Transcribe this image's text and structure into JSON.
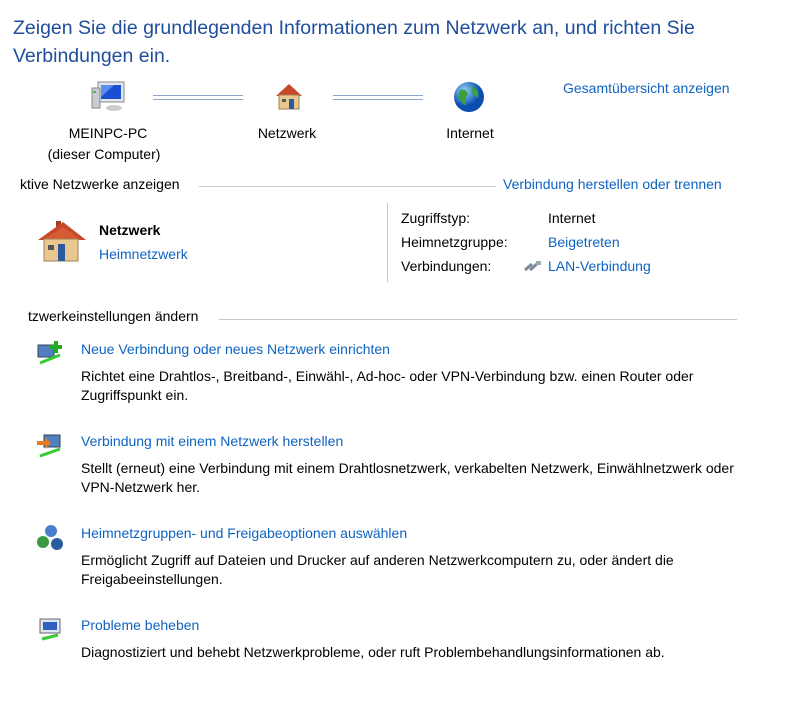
{
  "header": {
    "line1": "Zeigen Sie die grundlegenden Informationen zum Netzwerk an, und richten Sie",
    "line2": "Verbindungen ein."
  },
  "map": {
    "computer_name": "MEINPC-PC",
    "computer_sub": "(dieser Computer)",
    "network": "Netzwerk",
    "internet": "Internet",
    "full_map_link": "Gesamtübersicht anzeigen"
  },
  "active": {
    "section_title": "ktive Netzwerke anzeigen",
    "connect_link": "Verbindung herstellen oder trennen",
    "network_name": "Netzwerk",
    "network_type": "Heimnetzwerk",
    "props": {
      "access_label": "Zugriffstyp:",
      "access_value": "Internet",
      "homegroup_label": "Heimnetzgruppe:",
      "homegroup_value": "Beigetreten",
      "connections_label": "Verbindungen:",
      "connections_value": "LAN-Verbindung"
    }
  },
  "settings": {
    "section_title": "tzwerkeinstellungen ändern",
    "tasks": [
      {
        "title": "Neue Verbindung oder neues Netzwerk einrichten",
        "desc": "Richtet eine Drahtlos-, Breitband-, Einwähl-, Ad-hoc- oder VPN-Verbindung bzw. einen Router oder Zugriffspunkt ein."
      },
      {
        "title": "Verbindung mit einem Netzwerk herstellen",
        "desc": "Stellt (erneut) eine Verbindung mit einem Drahtlosnetzwerk, verkabelten Netzwerk, Einwählnetzwerk oder VPN-Netzwerk her."
      },
      {
        "title": "Heimnetzgruppen- und Freigabeoptionen auswählen",
        "desc": "Ermöglicht Zugriff auf Dateien und Drucker auf anderen Netzwerkcomputern zu, oder ändert die Freigabeeinstellungen."
      },
      {
        "title": "Probleme beheben",
        "desc": "Diagnostiziert und behebt Netzwerkprobleme, oder ruft Problembehandlungsinformationen ab."
      }
    ]
  }
}
